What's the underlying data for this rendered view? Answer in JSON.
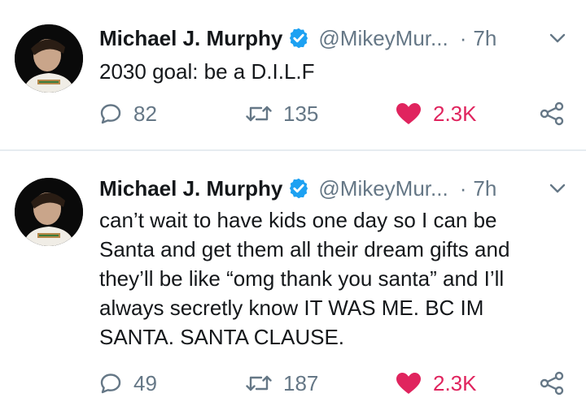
{
  "tweets": [
    {
      "author": {
        "name": "Michael J. Murphy",
        "handle": "@MikeyMur...",
        "verified": true
      },
      "time_separator": "·",
      "time": "7h",
      "text": "2030 goal: be a D.I.L.F",
      "stats": {
        "replies": "82",
        "retweets": "135",
        "likes": "2.3K",
        "liked": true
      }
    },
    {
      "author": {
        "name": "Michael J. Murphy",
        "handle": "@MikeyMur...",
        "verified": true
      },
      "time_separator": "·",
      "time": "7h",
      "text": "can’t wait to have kids one day so I can be\nSanta and get them all their dream gifts and\nthey’ll be like “omg thank you santa” and I’ll\nalways secretly know IT WAS ME. BC IM\nSANTA. SANTA CLAUSE.",
      "stats": {
        "replies": "49",
        "retweets": "187",
        "likes": "2.3K",
        "liked": true
      }
    }
  ],
  "colors": {
    "verified_blue": "#1da1f2",
    "like_red": "#e0245e",
    "muted_gray": "#657786",
    "text_dark": "#14171a",
    "divider": "#e6ecf0"
  }
}
